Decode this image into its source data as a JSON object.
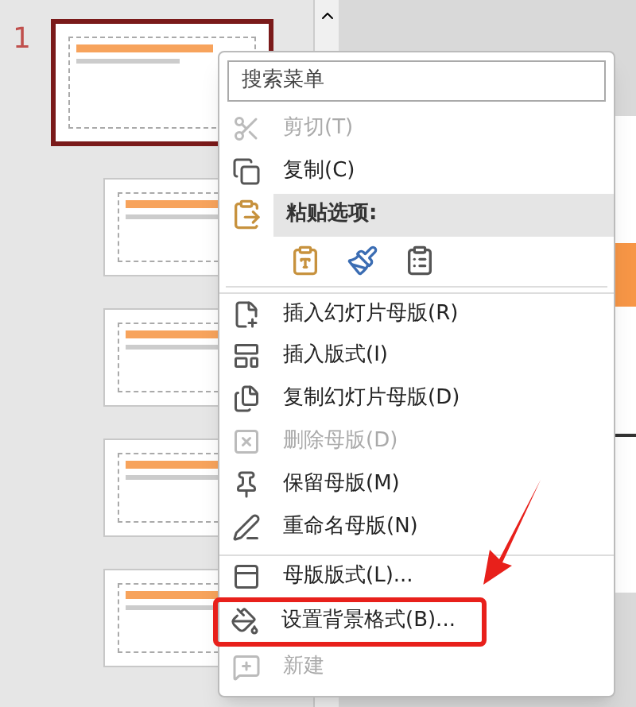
{
  "slides": [
    {
      "number": "1",
      "selected": true
    },
    {
      "selected": false
    },
    {
      "selected": false
    },
    {
      "selected": false
    },
    {
      "selected": false
    }
  ],
  "context_menu": {
    "search": {
      "placeholder": "搜索菜单"
    },
    "items": [
      {
        "kind": "command",
        "label": "剪切(T)",
        "disabled": true,
        "annotated": false,
        "separator_before": false
      },
      {
        "kind": "command",
        "label": "复制(C)",
        "disabled": false,
        "annotated": false,
        "separator_before": false
      },
      {
        "kind": "header",
        "label": "粘贴选项:"
      },
      {
        "kind": "paste_options"
      },
      {
        "kind": "command",
        "label": "插入幻灯片母版(R)",
        "disabled": false,
        "annotated": false,
        "separator_before": true
      },
      {
        "kind": "command",
        "label": "插入版式(I)",
        "disabled": false,
        "annotated": false,
        "separator_before": false
      },
      {
        "kind": "command",
        "label": "复制幻灯片母版(D)",
        "disabled": false,
        "annotated": false,
        "separator_before": false
      },
      {
        "kind": "command",
        "label": "删除母版(D)",
        "disabled": true,
        "annotated": false,
        "separator_before": false
      },
      {
        "kind": "command",
        "label": "保留母版(M)",
        "disabled": false,
        "annotated": false,
        "separator_before": false
      },
      {
        "kind": "command",
        "label": "重命名母版(N)",
        "disabled": false,
        "annotated": false,
        "separator_before": false
      },
      {
        "kind": "command",
        "label": "母版版式(L)...",
        "disabled": false,
        "annotated": false,
        "separator_before": true
      },
      {
        "kind": "command",
        "label": "设置背景格式(B)...",
        "disabled": false,
        "annotated": true,
        "separator_before": false
      },
      {
        "kind": "command",
        "label": "新建",
        "disabled": true,
        "annotated": false,
        "separator_before": false
      }
    ]
  }
}
